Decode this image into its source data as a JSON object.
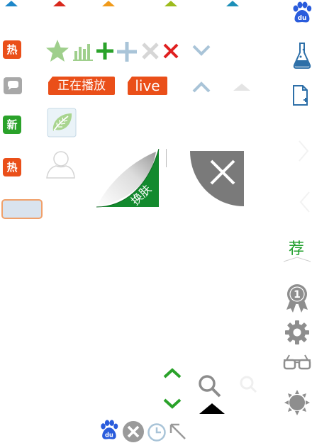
{
  "colors": {
    "blue": "#1d87c9",
    "red": "#d9281c",
    "orange": "#f09a1a",
    "yellowgreen": "#9dbb1c",
    "teal": "#1c8fb8",
    "hot": "#ea4f19",
    "new": "#2aa22a",
    "green": "#2aa22a",
    "lightgreen": "#9fcf8c",
    "lightblue": "#a9c4d8",
    "gray": "#8c8c8c",
    "darkgray": "#7a7a7a"
  },
  "badges": {
    "hot_1": "热",
    "new": "新",
    "hot_2": "热"
  },
  "tags": {
    "now_playing": "正在播放",
    "live": "live"
  },
  "skin_label": "换肤",
  "recommend_label": "荐",
  "medal_number": "1",
  "icons": [
    "triangle-up-icon",
    "star-icon",
    "bar-chart-icon",
    "plus-icon",
    "close-icon",
    "chevron-down-icon",
    "chevron-up-icon",
    "chat-bubble-icon",
    "leaf-icon",
    "user-avatar-icon",
    "page-curl-icon",
    "close-corner-icon",
    "baidu-paw-icon",
    "flask-icon",
    "add-file-icon",
    "medal-icon",
    "gear-icon",
    "glasses-icon",
    "sun-icon",
    "search-icon",
    "clock-icon",
    "arrow-top-left-icon"
  ]
}
